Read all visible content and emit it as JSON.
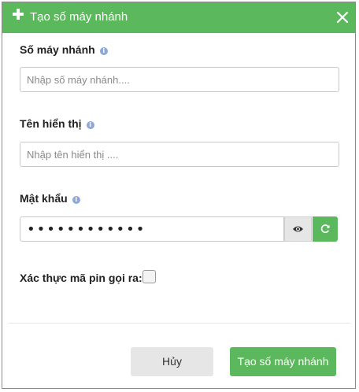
{
  "dialog": {
    "title": "Tạo số máy nhánh"
  },
  "fields": {
    "extension": {
      "label": "Số máy nhánh",
      "placeholder": "Nhập số máy nhánh...."
    },
    "display_name": {
      "label": "Tên hiển thị",
      "placeholder": "Nhập tên hiển thị ...."
    },
    "password": {
      "label": "Mật khẩu",
      "value": "••••••••••••"
    },
    "pin_verify": {
      "label": "Xác thực mã pin gọi ra:",
      "checked": false
    }
  },
  "icons": {
    "info": "i",
    "plus": "plus-icon",
    "close": "close-icon",
    "eye": "eye-icon",
    "refresh": "refresh-icon"
  },
  "buttons": {
    "cancel": "Hủy",
    "create": "Tạo số máy nhánh"
  },
  "colors": {
    "accent": "#5cb85c",
    "info": "#8fa8d6",
    "secondary_button": "#e6e6e6"
  }
}
